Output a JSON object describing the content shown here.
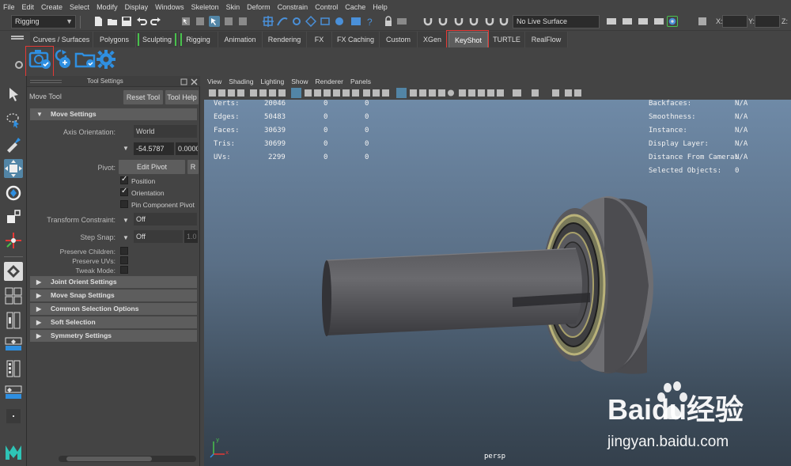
{
  "menu": [
    "File",
    "Edit",
    "Create",
    "Select",
    "Modify",
    "Display",
    "Windows",
    "Skeleton",
    "Skin",
    "Deform",
    "Constrain",
    "Control",
    "Cache",
    "Help"
  ],
  "status_line": {
    "mode": "Rigging",
    "live_surface": "No Live Surface",
    "coord_labels": [
      "X:",
      "Y:",
      "Z:"
    ]
  },
  "shelf_tabs": [
    "Curves / Surfaces",
    "Polygons",
    "Sculpting",
    "Rigging",
    "Animation",
    "Rendering",
    "FX",
    "FX Caching",
    "Custom",
    "XGen",
    "KeyShot",
    "TURTLE",
    "RealFlow"
  ],
  "active_shelf_tab": "KeyShot",
  "tool_settings": {
    "panel_title": "Tool Settings",
    "tool_name": "Move Tool",
    "reset_button": "Reset Tool",
    "help_button": "Tool Help",
    "section_move": "Move Settings",
    "axis_orientation_label": "Axis Orientation:",
    "axis_orientation_value": "World",
    "axis_value_1": "-54.5787",
    "axis_value_2": "0.0000",
    "pivot_label": "Pivot:",
    "edit_pivot_button": "Edit Pivot",
    "reset_pivot_partial": "R",
    "position_label": "Position",
    "orientation_label": "Orientation",
    "pin_component_label": "Pin Component Pivot",
    "transform_constraint_label": "Transform Constraint:",
    "transform_constraint_value": "Off",
    "step_snap_label": "Step Snap:",
    "step_snap_value": "Off",
    "step_snap_amount": "1.0",
    "preserve_children_label": "Preserve Children:",
    "preserve_uvs_label": "Preserve UVs:",
    "tweak_mode_label": "Tweak Mode:",
    "collapsed_sections": [
      "Joint Orient Settings",
      "Move Snap Settings",
      "Common Selection Options",
      "Soft Selection",
      "Symmetry Settings"
    ]
  },
  "viewport_menu": [
    "View",
    "Shading",
    "Lighting",
    "Show",
    "Renderer",
    "Panels"
  ],
  "hud_left": {
    "rows": [
      {
        "label": "Verts:",
        "v1": "20046",
        "v2": "0",
        "v3": "0"
      },
      {
        "label": "Edges:",
        "v1": "50483",
        "v2": "0",
        "v3": "0"
      },
      {
        "label": "Faces:",
        "v1": "30639",
        "v2": "0",
        "v3": "0"
      },
      {
        "label": "Tris:",
        "v1": "30699",
        "v2": "0",
        "v3": "0"
      },
      {
        "label": "UVs:",
        "v1": "2299",
        "v2": "0",
        "v3": "0"
      }
    ]
  },
  "hud_right": {
    "rows": [
      {
        "label": "Backfaces:",
        "value": "N/A"
      },
      {
        "label": "Smoothness:",
        "value": "N/A"
      },
      {
        "label": "Instance:",
        "value": "N/A"
      },
      {
        "label": "Display Layer:",
        "value": "N/A"
      },
      {
        "label": "Distance From Camera:",
        "value": "N/A"
      },
      {
        "label": "Selected Objects:",
        "value": "0"
      }
    ]
  },
  "camera_name": "persp",
  "axis_labels": {
    "y": "y",
    "x": "x"
  },
  "watermark": {
    "brand": "Baidu经验",
    "url": "jingyan.baidu.com"
  },
  "colors": {
    "highlight": "#e53935",
    "active_tool": "#5285a6",
    "keyshot_icon": "#2f8fe0",
    "viewport_top": "#6f8aa7",
    "viewport_bottom": "#34404c"
  }
}
